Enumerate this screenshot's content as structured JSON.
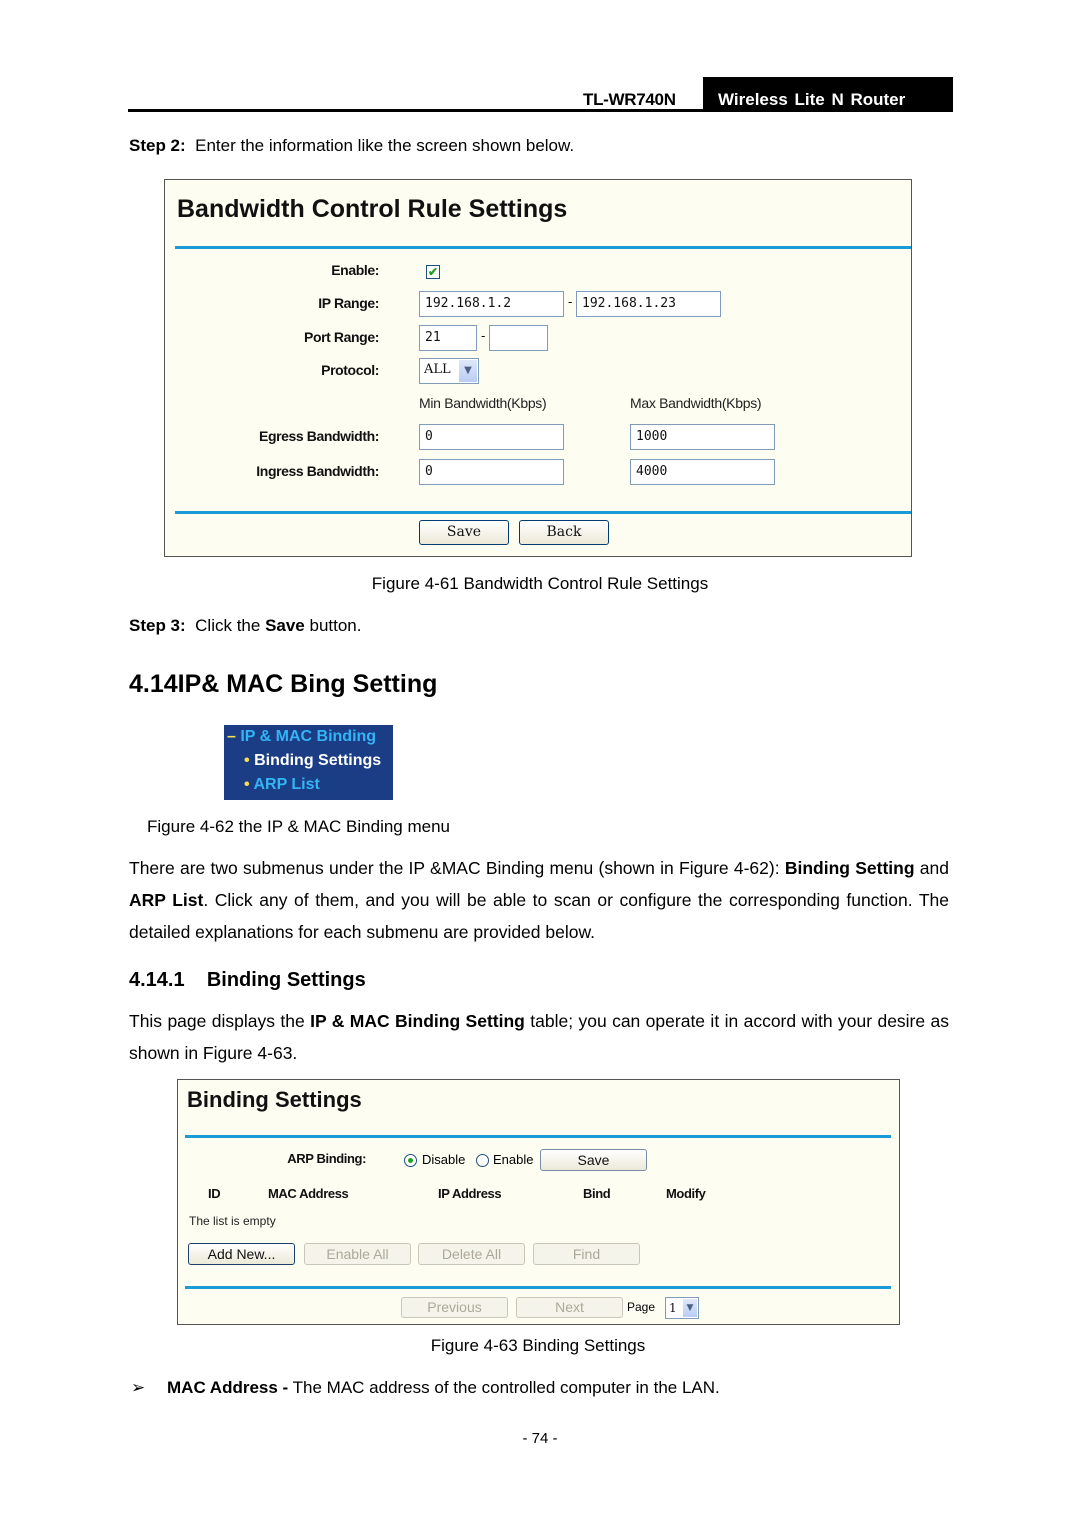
{
  "header": {
    "model": "TL-WR740N",
    "product": "Wireless  Lite  N  Router"
  },
  "step2": {
    "label": "Step 2:",
    "text": "Enter the information like the screen shown below."
  },
  "figure61": {
    "title": "Bandwidth Control Rule Settings",
    "enable_label": "Enable:",
    "enable_checked": true,
    "check_glyph": "✔",
    "ip_range_label": "IP Range:",
    "ip_start": "192.168.1.2",
    "ip_end": "192.168.1.23",
    "dash": "-",
    "port_range_label": "Port Range:",
    "port_start": "21",
    "port_end": "",
    "protocol_label": "Protocol:",
    "protocol_value": "ALL",
    "dropdown_glyph": "▼",
    "min_bw_header": "Min Bandwidth(Kbps)",
    "max_bw_header": "Max Bandwidth(Kbps)",
    "egress_label": "Egress Bandwidth:",
    "egress_min": "0",
    "egress_max": "1000",
    "ingress_label": "Ingress Bandwidth:",
    "ingress_min": "0",
    "ingress_max": "4000",
    "save_button": "Save",
    "back_button": "Back",
    "caption": "Figure 4-61 Bandwidth Control Rule Settings"
  },
  "step3": {
    "label": "Step 3:",
    "text_before": "Click the",
    "bold": "Save",
    "text_after": "button."
  },
  "section_heading": "4.14IP& MAC Bing Setting",
  "figure62": {
    "menu": {
      "parent": {
        "glyph": "–",
        "label": "IP & MAC Binding"
      },
      "items": [
        {
          "glyph": "•",
          "label": "Binding Settings",
          "active": true
        },
        {
          "glyph": "•",
          "label": "ARP List",
          "active": false
        }
      ]
    },
    "colors": {
      "background": "#1b3d85",
      "link": "#33b5f5",
      "active": "#ffffff",
      "bullet": "#f5e050"
    },
    "caption": "Figure 4-62 the IP & MAC Binding menu"
  },
  "intro_paragraph": {
    "p1": "There are two submenus under the IP &MAC Binding menu (shown in Figure 4-62):",
    "b1": "Binding Setting",
    "p2": "and",
    "b2": "ARP List",
    "p3": ". Click any of them, and you will be able to scan or configure the corresponding function. The detailed explanations for each submenu are provided below."
  },
  "subsection_heading": {
    "number": "4.14.1",
    "title": "Binding Settings"
  },
  "subsection_paragraph": {
    "p1": "This page displays the",
    "b1": "IP & MAC Binding Setting",
    "p2": "table; you can operate it in accord with your desire as shown in Figure 4-63."
  },
  "figure63": {
    "title": "Binding Settings",
    "arp_binding_label": "ARP Binding:",
    "radio_disable": "Disable",
    "radio_enable": "Enable",
    "selected": "Disable",
    "save_button": "Save",
    "columns": [
      "ID",
      "MAC Address",
      "IP Address",
      "Bind",
      "Modify"
    ],
    "empty_text": "The list is empty",
    "buttons": [
      {
        "label": "Add New...",
        "enabled": true
      },
      {
        "label": "Enable All",
        "enabled": false
      },
      {
        "label": "Delete All",
        "enabled": false
      },
      {
        "label": "Find",
        "enabled": false
      }
    ],
    "previous_button": "Previous",
    "next_button": "Next",
    "page_label": "Page",
    "page_value": "1",
    "dropdown_glyph": "▼",
    "caption": "Figure 4-63 Binding Settings"
  },
  "bullet": {
    "glyph": "➢",
    "bold": "MAC Address -",
    "text": "The MAC address of the controlled computer in the LAN."
  },
  "page_number": "- 74 -"
}
